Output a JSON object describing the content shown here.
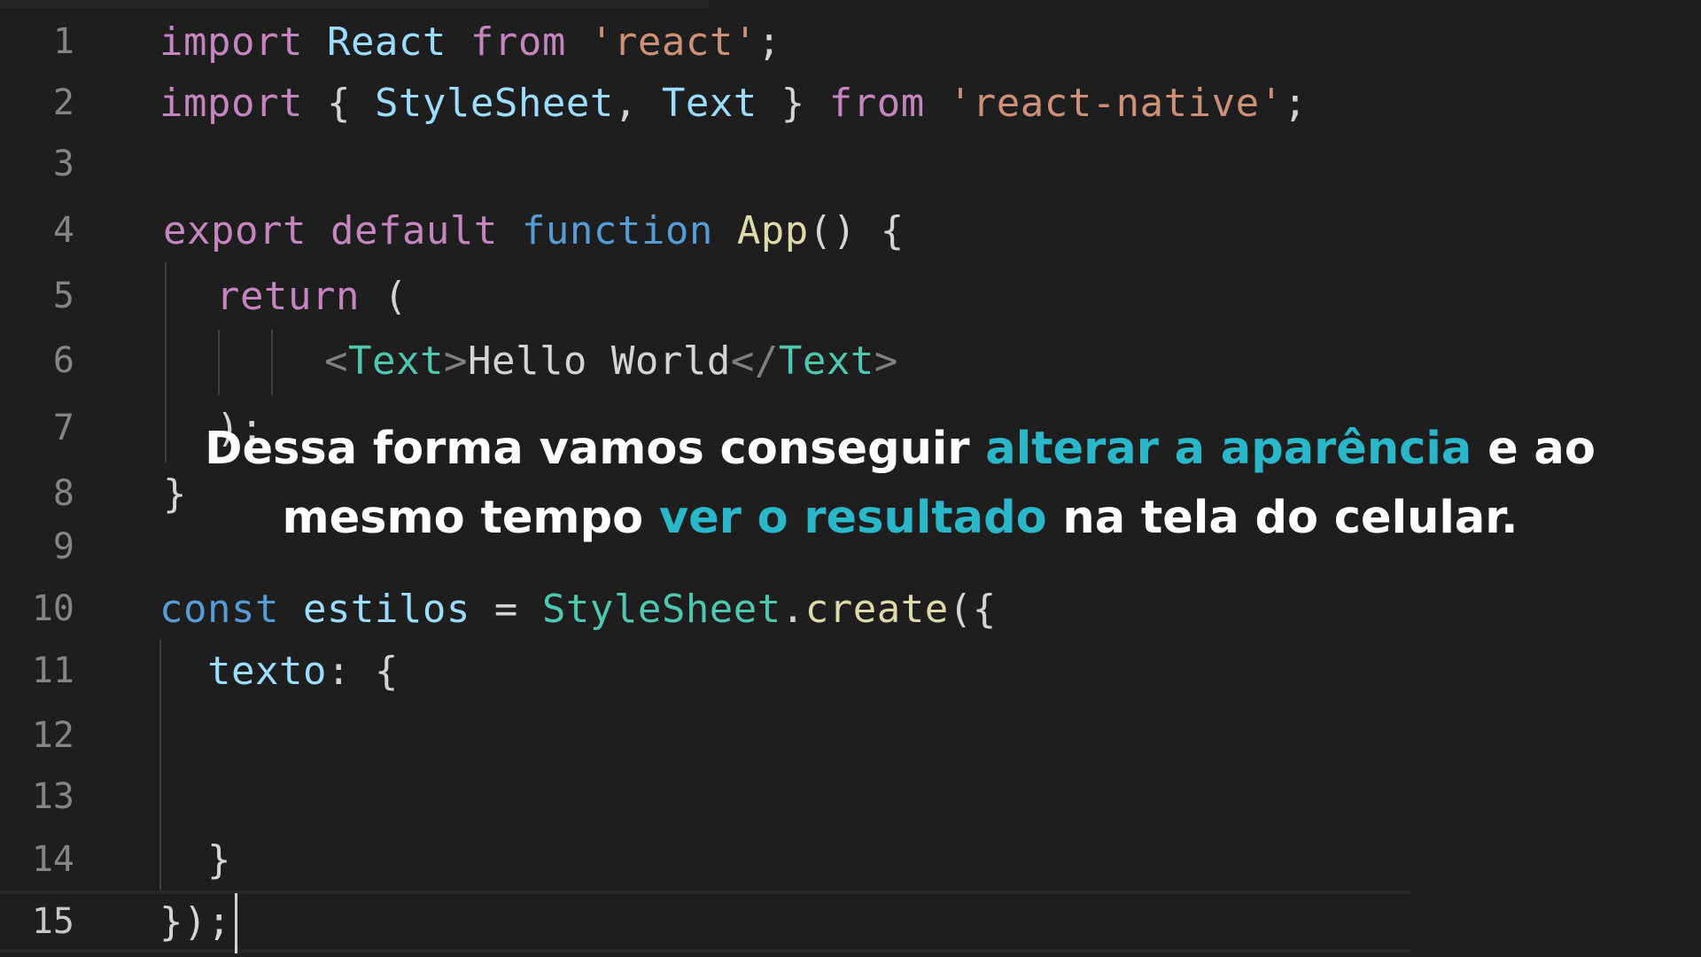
{
  "editor": {
    "line_numbers": [
      "1",
      "2",
      "3",
      "4",
      "5",
      "6",
      "7",
      "8",
      "9",
      "10",
      "11",
      "12",
      "13",
      "14",
      "15"
    ],
    "current_line": "15",
    "lines": {
      "l1": [
        "import",
        " ",
        "React",
        " ",
        "from",
        " ",
        "'react'",
        ";"
      ],
      "l2": [
        "import",
        " { ",
        "StyleSheet",
        ", ",
        "Text",
        " } ",
        "from",
        " ",
        "'react-native'",
        ";"
      ],
      "l4": [
        "export",
        " ",
        "default",
        " ",
        "function",
        " ",
        "App",
        "() {"
      ],
      "l5": [
        "return",
        " ("
      ],
      "l6": [
        "<",
        "Text",
        ">",
        "Hello World",
        "</",
        "Text",
        ">"
      ],
      "l7": [
        ");"
      ],
      "l8": [
        "}"
      ],
      "l10": [
        "const",
        " ",
        "estilos",
        " = ",
        "StyleSheet",
        ".",
        "create",
        "({"
      ],
      "l11": [
        "texto",
        ": {"
      ],
      "l14": [
        "}"
      ],
      "l15": [
        "});"
      ]
    }
  },
  "caption": {
    "line1_a": "Dessa forma vamos conseguir ",
    "line1_hl": "alterar a aparência",
    "line1_b": " e ao",
    "line2_a": "mesmo tempo ",
    "line2_hl": "ver o resultado",
    "line2_b": " na tela do celular."
  },
  "colors": {
    "background": "#1e1e1e",
    "caption_highlight": "#2ab7ca",
    "keyword_control": "#c586c0",
    "keyword": "#569cd6",
    "string": "#ce9178",
    "identifier": "#9cdcfe",
    "function": "#dcdcaa",
    "type": "#4ec9b0"
  }
}
